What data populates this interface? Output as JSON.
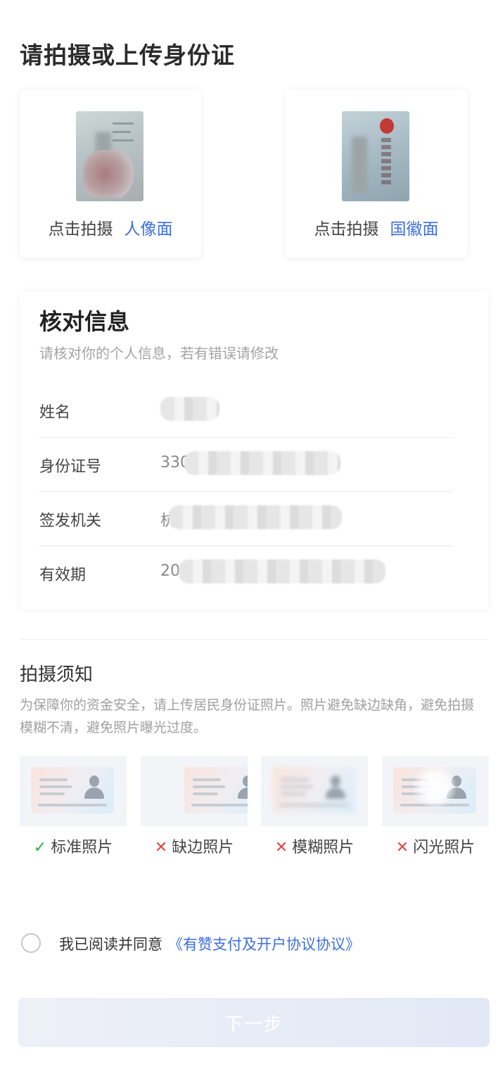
{
  "header": {
    "title": "请拍摄或上传身份证"
  },
  "upload": {
    "front": {
      "action": "点击拍摄",
      "side": "人像面"
    },
    "back": {
      "action": "点击拍摄",
      "side": "国徽面"
    }
  },
  "verify": {
    "title": "核对信息",
    "subtitle": "请核对你的个人信息，若有错误请修改",
    "rows": [
      {
        "label": "姓名",
        "value": ""
      },
      {
        "label": "身份证号",
        "value": "330"
      },
      {
        "label": "签发机关",
        "value": "杭"
      },
      {
        "label": "有效期",
        "value": "20"
      }
    ]
  },
  "notice": {
    "title": "拍摄须知",
    "text": "为保障你的资金安全，请上传居民身份证照片。照片避免缺边缺角，避免拍摄模糊不清，避免照片曝光过度。",
    "examples": [
      {
        "label": "标准照片",
        "mark": "✓",
        "status": "ok"
      },
      {
        "label": "缺边照片",
        "mark": "✕",
        "status": "bad"
      },
      {
        "label": "模糊照片",
        "mark": "✕",
        "status": "bad"
      },
      {
        "label": "闪光照片",
        "mark": "✕",
        "status": "bad"
      }
    ]
  },
  "agreement": {
    "text": "我已阅读并同意",
    "link": "《有赞支付及开户协议协议》",
    "checked": false
  },
  "footer": {
    "next_label": "下一步"
  },
  "colors": {
    "link": "#3d6ee0",
    "ok": "#2bb24c",
    "bad": "#e5474a"
  }
}
